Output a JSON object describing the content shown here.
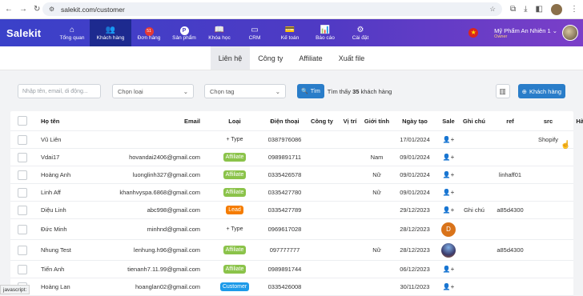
{
  "browser": {
    "url": "salekit.com/customer"
  },
  "app": {
    "logo": "Salekit"
  },
  "menu": [
    {
      "label": "Tổng quan",
      "icon": "⌂",
      "icon_name": "home-icon"
    },
    {
      "label": "Khách hàng",
      "icon": "👥",
      "icon_name": "users-icon",
      "active": true
    },
    {
      "label": "Đơn hàng",
      "icon": "51",
      "icon_name": "orders-icon"
    },
    {
      "label": "Sản phẩm",
      "icon": "P",
      "icon_name": "product-icon"
    },
    {
      "label": "Khóa học",
      "icon": "📖",
      "icon_name": "book-icon"
    },
    {
      "label": "CRM",
      "icon": "▭",
      "icon_name": "crm-icon"
    },
    {
      "label": "Kế toán",
      "icon": "💳",
      "icon_name": "accounting-icon"
    },
    {
      "label": "Báo cáo",
      "icon": "📊",
      "icon_name": "report-icon"
    },
    {
      "label": "Cài đặt",
      "icon": "⚙",
      "icon_name": "settings-icon"
    }
  ],
  "user": {
    "name": "Mỹ Phẩm An Nhiên 1",
    "role": "Owner"
  },
  "tabs": [
    "Liên hệ",
    "Công ty",
    "Affiliate",
    "Xuất file"
  ],
  "filter": {
    "search_placeholder": "Nhập tên, email, di động...",
    "select_type": "Chọn loại",
    "select_tag": "Chọn tag",
    "search_btn": "Tìm",
    "found_prefix": "Tìm thấy",
    "found_count": "35",
    "found_suffix": "khách hàng",
    "add_btn": "Khách hàng"
  },
  "columns": {
    "name": "Họ tên",
    "email": "Email",
    "type": "Loại",
    "phone": "Điện thoại",
    "company": "Công ty",
    "position": "Vị trí",
    "gender": "Giới tính",
    "created": "Ngày tạo",
    "sale": "Sale",
    "note": "Ghi chú",
    "ref": "ref",
    "src": "src",
    "action": "Hành động"
  },
  "rows": [
    {
      "name": "Vũ Liên",
      "email": "",
      "type": "+ Type",
      "phone": "0387976086",
      "gender": "",
      "created": "17/01/2024",
      "sale": "add-user",
      "note": "",
      "ref": "",
      "src": "Shopify"
    },
    {
      "name": "Vdai17",
      "email": "hovandai2406@gmail.com",
      "type": "Affiliate",
      "phone": "0989891711",
      "gender": "Nam",
      "created": "09/01/2024",
      "sale": "add-user",
      "note": "",
      "ref": "",
      "src": ""
    },
    {
      "name": "Hoàng Anh",
      "email": "luonglinh327@gmail.com",
      "type": "Affiliate",
      "phone": "0335426578",
      "gender": "Nữ",
      "created": "09/01/2024",
      "sale": "add-user",
      "note": "",
      "ref": "linhaff01",
      "src": ""
    },
    {
      "name": "Linh Aff",
      "email": "khanhvyspa.6868@gmail.com",
      "type": "Affiliate",
      "phone": "0335427780",
      "gender": "Nữ",
      "created": "09/01/2024",
      "sale": "add-user",
      "note": "",
      "ref": "",
      "src": ""
    },
    {
      "name": "Diệu Linh",
      "email": "abc998@gmail.com",
      "type": "Lead",
      "phone": "0335427789",
      "gender": "",
      "created": "29/12/2023",
      "sale": "add-user",
      "note": "Ghi chú",
      "ref": "a85d4300",
      "src": ""
    },
    {
      "name": "Đức Minh",
      "email": "minhnd@gmail.com",
      "type": "+ Type",
      "phone": "0969617028",
      "gender": "",
      "created": "28/12/2023",
      "sale": "D",
      "note": "",
      "ref": "",
      "src": ""
    },
    {
      "name": "Nhung Test",
      "email": "lenhung.h96@gmail.com",
      "type": "Affiliate",
      "phone": "097777777",
      "gender": "Nữ",
      "created": "28/12/2023",
      "sale": "photo",
      "note": "",
      "ref": "a85d4300",
      "src": ""
    },
    {
      "name": "Tiến Anh",
      "email": "tienanh7.11.99@gmail.com",
      "type": "Affiliate",
      "phone": "0989891744",
      "gender": "",
      "created": "06/12/2023",
      "sale": "add-user",
      "note": "",
      "ref": "",
      "src": ""
    },
    {
      "name": "Hoàng Lan",
      "email": "hoanglan02@gmail.com",
      "type": "Customer",
      "phone": "0335426008",
      "gender": "",
      "created": "30/11/2023",
      "sale": "add-user",
      "note": "",
      "ref": "",
      "src": ""
    }
  ],
  "statusbar": "javascript:"
}
